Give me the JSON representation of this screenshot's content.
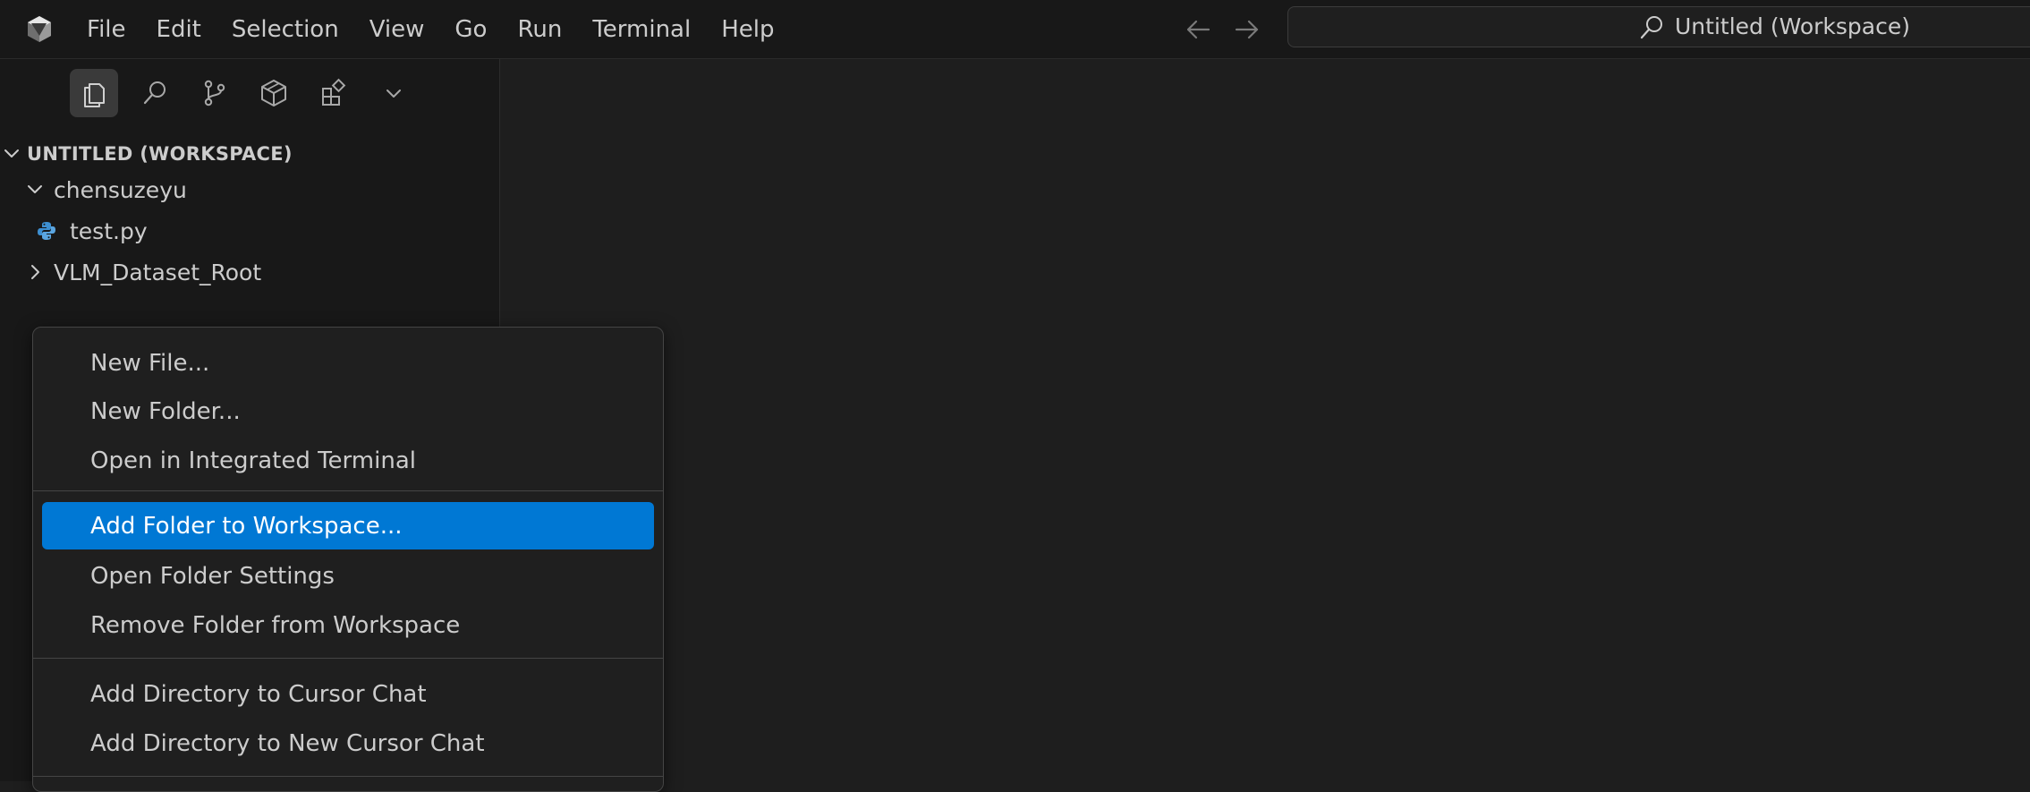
{
  "menubar": {
    "items": [
      "File",
      "Edit",
      "Selection",
      "View",
      "Go",
      "Run",
      "Terminal",
      "Help"
    ]
  },
  "command_center": {
    "title": "Untitled (Workspace)",
    "icon": "search-icon"
  },
  "activity_bar": {
    "icons": [
      "explorer-icon",
      "search-icon",
      "source-control-icon",
      "cube-icon",
      "extensions-icon",
      "chevron-down-icon"
    ],
    "active": "explorer-icon"
  },
  "explorer": {
    "section_title": "UNTITLED (WORKSPACE)",
    "tree": [
      {
        "label": "chensuzeyu",
        "type": "folder",
        "expanded": true
      },
      {
        "label": "test.py",
        "type": "python-file"
      },
      {
        "label": "VLM_Dataset_Root",
        "type": "folder",
        "expanded": false
      }
    ]
  },
  "context_menu": {
    "groups": [
      [
        "New File...",
        "New Folder...",
        "Open in Integrated Terminal"
      ],
      [
        "Add Folder to Workspace...",
        "Open Folder Settings",
        "Remove Folder from Workspace"
      ],
      [
        "Add Directory to Cursor Chat",
        "Add Directory to New Cursor Chat"
      ]
    ],
    "highlighted": "Add Folder to Workspace...",
    "highlight_color": "#0078d4"
  }
}
